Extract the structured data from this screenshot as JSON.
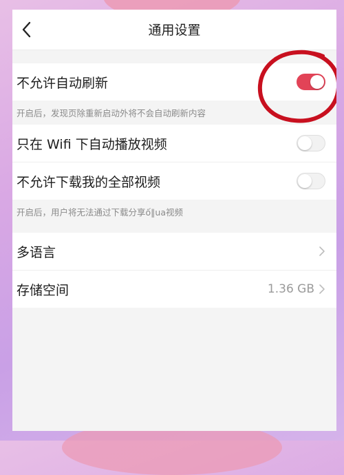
{
  "header": {
    "title": "通用设置"
  },
  "section_refresh": {
    "label": "不允许自动刷新",
    "toggle_on": true,
    "hint": "开启后，发现页除重新启动外将不会自动刷新内容"
  },
  "section_video": {
    "rows": [
      {
        "label": "只在 Wifi 下自动播放视频",
        "toggle_on": false
      },
      {
        "label": "不允许下载我的全部视频",
        "toggle_on": false
      }
    ],
    "hint": "开启后，用户将无法通过下载分享ố‖ua视频"
  },
  "section_misc": {
    "language_label": "多语言",
    "storage_label": "存储空间",
    "storage_value": "1.36 GB"
  },
  "colors": {
    "toggle_active": "#e24357",
    "annotation": "#c8101f"
  }
}
